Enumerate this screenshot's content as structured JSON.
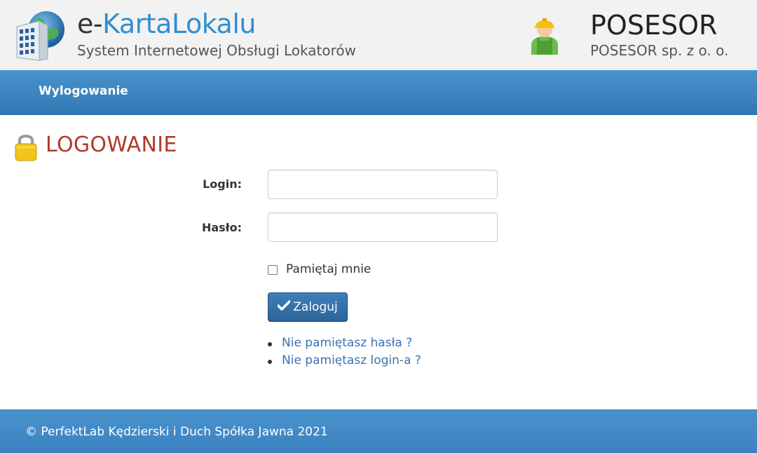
{
  "header": {
    "brand_prefix": "e-",
    "brand_accent": "KartaLokalu",
    "subtitle": "System Internetowej Obsługi Lokatorów",
    "company_name": "POSESOR",
    "company_full": "POSESOR sp. z o. o.",
    "logo_icon": "building-globe-icon",
    "company_icon": "worker-icon"
  },
  "nav": {
    "logout": "Wylogowanie"
  },
  "page": {
    "title": "LOGOWANIE",
    "icon": "lock-icon"
  },
  "form": {
    "login_label": "Login:",
    "login_value": "",
    "password_label": "Hasło:",
    "password_value": "",
    "remember_label": "Pamiętaj mnie",
    "remember_checked": false,
    "submit_label": "Zaloguj"
  },
  "links": [
    "Nie pamiętasz hasła ?",
    "Nie pamiętasz login-a ?"
  ],
  "footer": {
    "text": "© PerfektLab Kędzierski i Duch Spółka Jawna 2021"
  },
  "colors": {
    "accent": "#2f8fd0",
    "nav_blue": "#3a84c3",
    "title_red": "#b03a2a",
    "link_blue": "#3a73b0"
  }
}
